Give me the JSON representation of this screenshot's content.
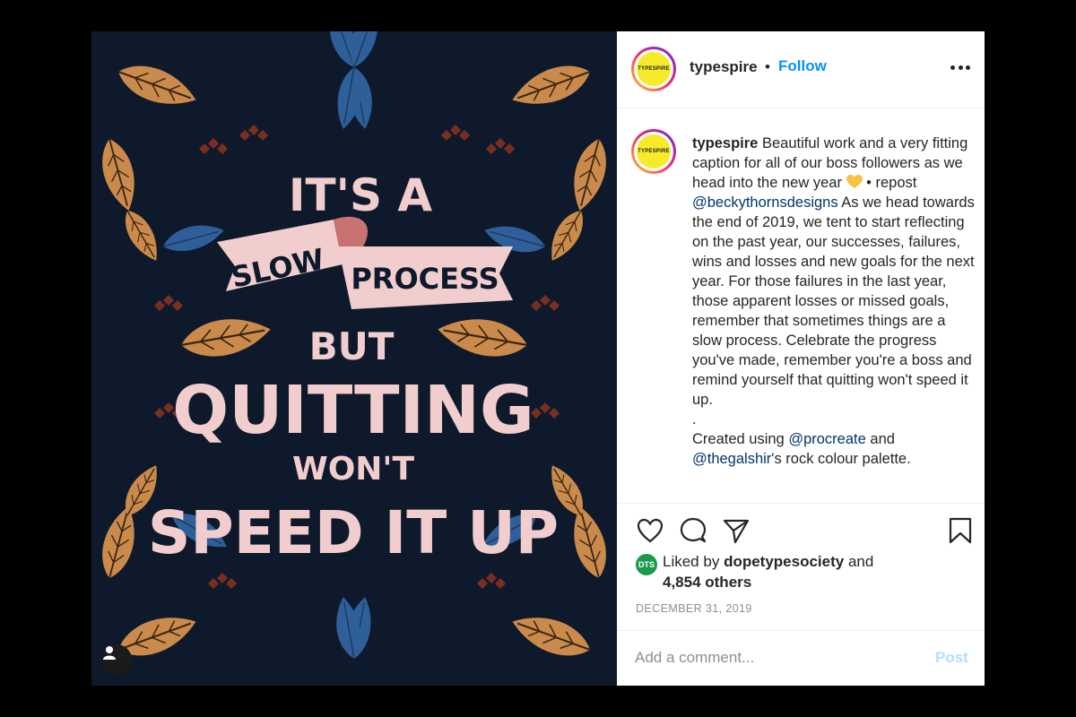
{
  "header": {
    "username": "typespire",
    "separator": "•",
    "follow_label": "Follow",
    "avatar_text": "TYPESPIRE"
  },
  "artwork": {
    "line1": "IT'S A",
    "ribbon_left": "SLOW",
    "ribbon_right": "PROCESS",
    "line3": "BUT",
    "line4": "QUITTING",
    "line5": "WON'T",
    "line6": "SPEED IT UP"
  },
  "caption": {
    "username": "typespire",
    "text1": "Beautiful work and a very fitting caption for all of our boss followers as we head into the new year",
    "repost_prefix": "• repost",
    "mention1": "@beckythornsdesigns",
    "text2": "As we head towards the end of 2019, we tent to start reflecting on the past year, our successes, failures, wins and losses and new goals for the next year. For those failures in the last year, those apparent losses or missed goals, remember that sometimes things are a slow process. Celebrate the progress you've made, remember you're a boss and remind yourself that quitting won't speed it up.",
    "dot": ".",
    "created_prefix": "Created using",
    "mention2": "@procreate",
    "and_word": "and",
    "mention3": "@thegalshir",
    "created_suffix": "'s rock colour palette."
  },
  "likes": {
    "avatar_text": "DTS",
    "prefix": "Liked by",
    "user": "dopetypesociety",
    "suffix": "and",
    "others": "4,854 others"
  },
  "date": "DECEMBER 31, 2019",
  "comment": {
    "placeholder": "Add a comment...",
    "post_label": "Post"
  },
  "colors": {
    "accent": "#0095f6",
    "artwork_bg": "#0e1a2c",
    "leaf_tan": "#c98a4b",
    "leaf_blue": "#2f5f99",
    "lettering_pink": "#f2cdcd",
    "ribbon_fold": "#c97272"
  }
}
